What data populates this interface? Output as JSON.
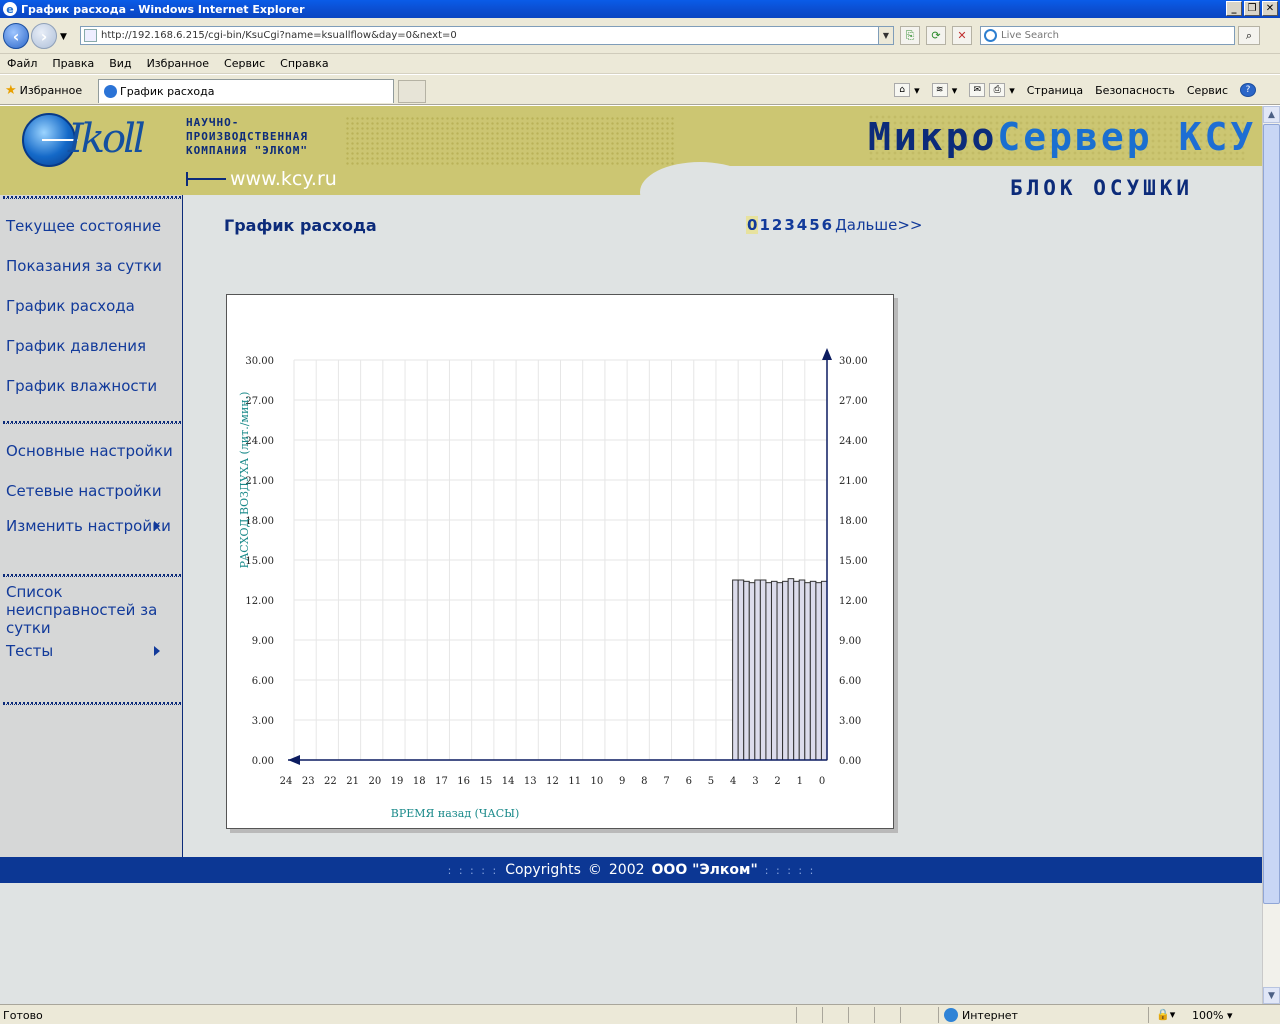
{
  "window": {
    "title": "График расхода - Windows Internet Explorer",
    "min": "_",
    "max": "❐",
    "close": "✕"
  },
  "toolbar": {
    "address": "http://192.168.6.215/cgi-bin/KsuCgi?name=ksuallflow&day=0&next=0",
    "search_placeholder": "Live Search"
  },
  "menu": [
    "Файл",
    "Правка",
    "Вид",
    "Избранное",
    "Сервис",
    "Справка"
  ],
  "favorites_label": "Избранное",
  "tab_title": "График расхода",
  "command_bar": {
    "page": "Страница",
    "safety": "Безопасность",
    "tools": "Сервис"
  },
  "banner": {
    "company_lines": [
      "НАУЧНО-",
      "ПРОИЗВОДСТВЕННАЯ",
      "КОМПАНИЯ \"ЭЛКОМ\""
    ],
    "site": "www.kcy.ru",
    "product_1": "Микро",
    "product_2": "Сервер",
    "product_3": "КСУ",
    "unit": "БЛОК ОСУШКИ"
  },
  "sidebar": {
    "group1": [
      "Текущее состояние",
      "Показания за сутки",
      "График расхода",
      "График давления",
      "График влажности"
    ],
    "group2": [
      "Основные настройки",
      "Сетевые настройки",
      "Изменить настройки"
    ],
    "group3_item1": "Список неисправностей за сутки",
    "group3_item2": "Тесты"
  },
  "page": {
    "title": "График расхода",
    "pager": [
      "0",
      "1",
      "2",
      "3",
      "4",
      "5",
      "6"
    ],
    "pager_next": "Дальше>>"
  },
  "chart_data": {
    "type": "bar",
    "xlabel": "ВРЕМЯ назад (ЧАСЫ)",
    "ylabel": "РАСХОД ВОЗДУХА (лит./мин.)",
    "ylim": [
      0,
      30
    ],
    "yticks": [
      "0.00",
      "3.00",
      "6.00",
      "9.00",
      "12.00",
      "15.00",
      "18.00",
      "21.00",
      "24.00",
      "27.00",
      "30.00"
    ],
    "xticks": [
      "24",
      "23",
      "22",
      "21",
      "20",
      "19",
      "18",
      "17",
      "16",
      "15",
      "14",
      "13",
      "12",
      "11",
      "10",
      "9",
      "8",
      "7",
      "6",
      "5",
      "4",
      "3",
      "2",
      "1",
      "0"
    ],
    "xlim": [
      0,
      24
    ],
    "bar_hours_back_start": 4.25,
    "bar_interval_hours": 0.25,
    "values": [
      13.5,
      13.5,
      13.4,
      13.3,
      13.5,
      13.5,
      13.3,
      13.4,
      13.3,
      13.4,
      13.6,
      13.4,
      13.5,
      13.3,
      13.4,
      13.3,
      13.4
    ],
    "bar_color": "#dcdcec",
    "grid": true
  },
  "footer": {
    "dots_left": ": : : : :",
    "copy": "Copyrights",
    "symbol": "©",
    "year": "2002",
    "company": "ООО \"Элком\"",
    "dots_right": ": : : : :"
  },
  "status": {
    "text": "Готово",
    "zone": "Интернет",
    "zoom": "100%"
  }
}
